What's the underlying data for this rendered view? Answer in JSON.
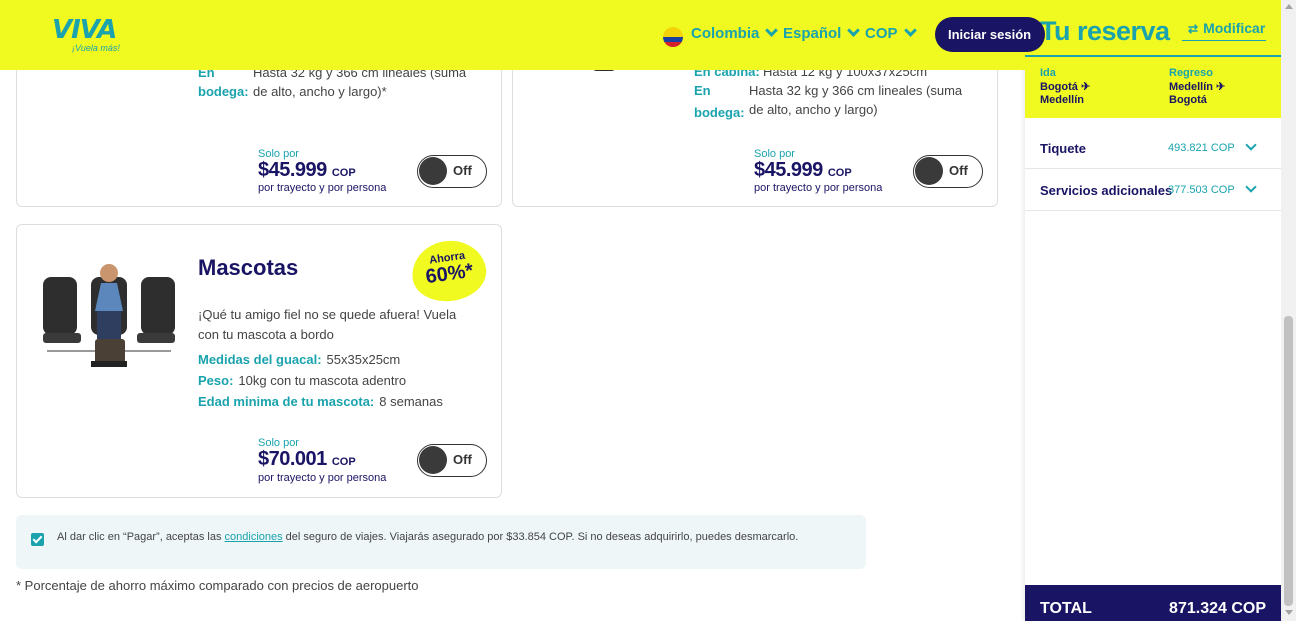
{
  "header": {
    "logo_text": "VIVA",
    "logo_tagline": "¡Vuela más!",
    "country": "Colombia",
    "language": "Español",
    "currency": "COP",
    "login_label": "Iniciar sesión"
  },
  "card_left_top": {
    "line1_label": "En",
    "line1_value": "Hasta 32 kg y 366 cm lineales (suma",
    "line2_label": "bodega:",
    "line2_value": "de alto, ancho y largo)*",
    "price_prefix": "Solo por",
    "price": "$45.999",
    "currency": "COP",
    "price_note": "por trayecto y por persona",
    "toggle_label": "Off"
  },
  "card_right_top": {
    "cabin_label": "En cabina:",
    "cabin_value": "Hasta 12 kg y 100x37x25cm",
    "hold_label_1": "En",
    "hold_label_2": "bodega:",
    "hold_value_1": "Hasta 32 kg y 366 cm lineales (suma",
    "hold_value_2": "de alto, ancho y largo)",
    "price_prefix": "Solo por",
    "price": "$45.999",
    "currency": "COP",
    "price_note": "por trayecto y por persona",
    "toggle_label": "Off"
  },
  "card_mascotas": {
    "title": "Mascotas",
    "badge_top": "Ahorra",
    "badge_value": "60%*",
    "description_1": "¡Qué tu amigo fiel no se quede afuera! Vuela",
    "description_2": "con tu mascota a bordo",
    "crate_label": "Medidas del guacal:",
    "crate_value": "55x35x25cm",
    "weight_label": "Peso:",
    "weight_value": "10kg con tu mascota adentro",
    "age_label": "Edad minima de tu mascota:",
    "age_value": "8 semanas",
    "price_prefix": "Solo por",
    "price": "$70.001",
    "currency": "COP",
    "price_note": "por trayecto y por persona",
    "toggle_label": "Off"
  },
  "insurance": {
    "checked": true,
    "text_before": "Al dar clic en “Pagar”, aceptas las ",
    "link": "condiciones",
    "text_after": " del seguro de viajes. Viajarás asegurado por $33.854 COP. Si no deseas adquirirlo, puedes desmarcarlo."
  },
  "footnote": "* Porcentaje de ahorro máximo comparado con precios de aeropuerto",
  "sidebar": {
    "title": "Tu reserva",
    "modify_label": "Modificar",
    "outbound_title": "Ida",
    "outbound_from": "Bogotá ✈",
    "outbound_to": "Medellín",
    "return_title": "Regreso",
    "return_from": "Medellín ✈",
    "return_to": "Bogotá",
    "ticket_label": "Tiquete",
    "ticket_value": "493.821 COP",
    "services_label": "Servicios adicionales",
    "services_value": "377.503 COP",
    "total_label": "TOTAL",
    "total_value": "871.324 COP"
  },
  "colors": {
    "brand_yellow": "#f0fa21",
    "brand_teal": "#1aa3ad",
    "brand_navy": "#1a1464"
  },
  "icons": [
    "colombia-flag-icon",
    "chevron-down-icon",
    "pet-seat-illustration",
    "airplane-icon",
    "swap-icon",
    "checkbox-icon"
  ]
}
